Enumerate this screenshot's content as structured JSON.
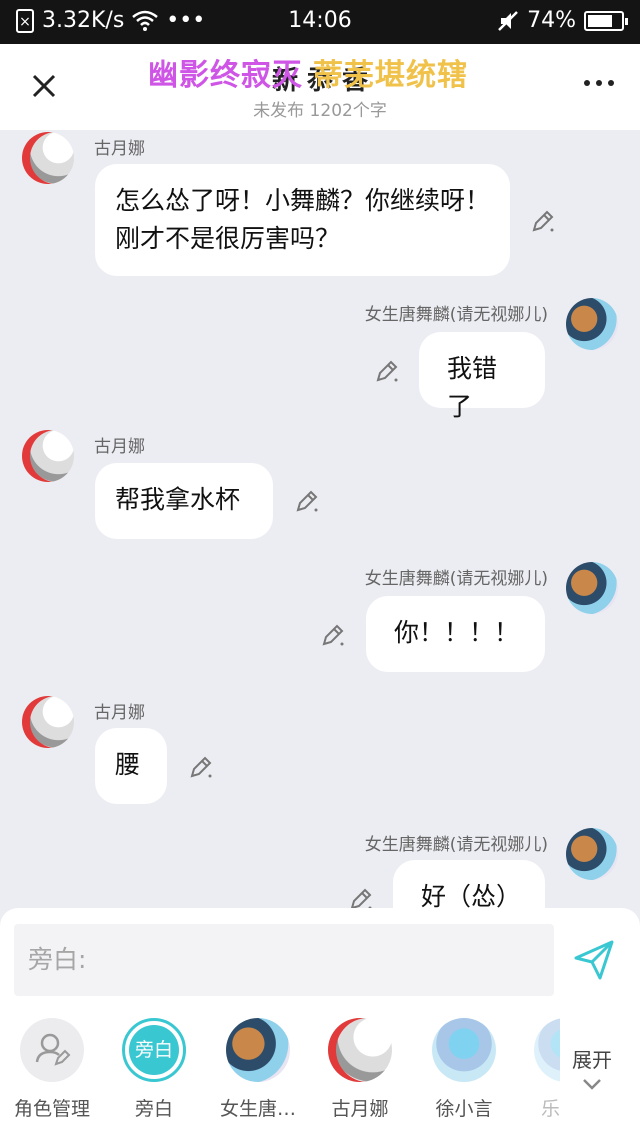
{
  "status_bar": {
    "network_speed": "3.32K/s",
    "time": "14:06",
    "battery": "74%",
    "battery_level": 0.74,
    "icons": [
      "sim-icon",
      "wifi-icon",
      "more-dots-icon",
      "mute-icon",
      "battery-icon"
    ]
  },
  "header": {
    "title": "新 忝 香",
    "subtitle": "未发布 1202个字",
    "watermark_left": "幽影终寂灭",
    "watermark_right": "蒂芜堪统辖"
  },
  "messages": [
    {
      "side": "left",
      "name": "古月娜",
      "text": "怎么怂了呀！小舞麟？你继续呀！刚才不是很厉害吗？"
    },
    {
      "side": "right",
      "name": "女生唐舞麟(请无视娜儿)",
      "text": "我错了"
    },
    {
      "side": "left",
      "name": "古月娜",
      "text": "帮我拿水杯"
    },
    {
      "side": "right",
      "name": "女生唐舞麟(请无视娜儿)",
      "text": "你！！！！"
    },
    {
      "side": "left",
      "name": "古月娜",
      "text": "腰"
    },
    {
      "side": "right",
      "name": "女生唐舞麟(请无视娜儿)",
      "text": "好（怂）"
    }
  ],
  "composer": {
    "placeholder": "旁白:"
  },
  "roles": [
    {
      "label": "角色管理"
    },
    {
      "label": "旁白",
      "avatar_text": "旁白"
    },
    {
      "label": "女生唐…"
    },
    {
      "label": "古月娜"
    },
    {
      "label": "徐小言"
    },
    {
      "label": "乐"
    }
  ],
  "expand_label": "展开",
  "colors": {
    "accent": "#39c7d2",
    "background": "#ecedf2",
    "watermark_purple": "#cf55e6",
    "watermark_gold": "#f0c24a"
  }
}
